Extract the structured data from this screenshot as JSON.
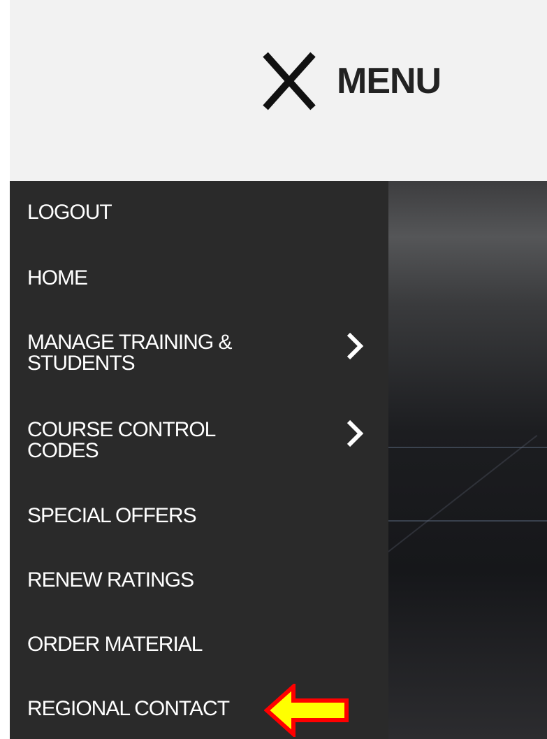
{
  "header": {
    "close_icon": "close-x-icon",
    "menu_label": "MENU"
  },
  "nav": {
    "items": [
      {
        "label": "LOGOUT",
        "has_submenu": false
      },
      {
        "label": "HOME",
        "has_submenu": false
      },
      {
        "label": "MANAGE TRAINING &\nSTUDENTS",
        "has_submenu": true
      },
      {
        "label": "COURSE CONTROL\nCODES",
        "has_submenu": true
      },
      {
        "label": "SPECIAL OFFERS",
        "has_submenu": false
      },
      {
        "label": "RENEW RATINGS",
        "has_submenu": false
      },
      {
        "label": "ORDER MATERIAL",
        "has_submenu": false
      },
      {
        "label": "REGIONAL CONTACT",
        "has_submenu": false
      }
    ]
  },
  "annotation": {
    "icon": "left-arrow-icon",
    "fill": "#ffff00",
    "stroke": "#ff0000"
  },
  "colors": {
    "header_bg": "#f2f2f2",
    "drawer_bg": "#2a2a2a",
    "drawer_text": "#ffffff",
    "menu_text": "#222222"
  }
}
